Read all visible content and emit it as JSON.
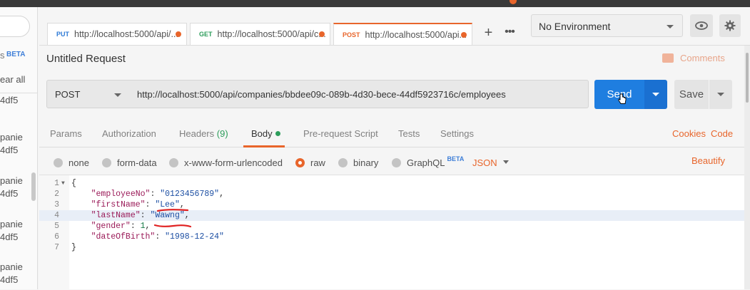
{
  "sidebar": {
    "s_fragment": "s",
    "beta": "BETA",
    "clear_all": "ear all",
    "items": [
      {
        "line1": "",
        "line2": "4df5"
      },
      {
        "line1": "panie",
        "line2": "4df5"
      },
      {
        "line1": "panie",
        "line2": "4df5"
      },
      {
        "line1": "panie",
        "line2": "4df5"
      },
      {
        "line1": "panie",
        "line2": "4df5"
      }
    ]
  },
  "tabs": [
    {
      "method": "PUT",
      "method_color": "#2d7ad6",
      "url": "http://localhost:5000/api/...",
      "active": false
    },
    {
      "method": "GET",
      "method_color": "#2d9d5b",
      "url": "http://localhost:5000/api/c...",
      "active": false
    },
    {
      "method": "POST",
      "method_color": "#e8652b",
      "url": "http://localhost:5000/api...",
      "active": true
    }
  ],
  "tab_actions": {
    "add": "+",
    "more": "•••"
  },
  "environment": {
    "selected": "No Environment"
  },
  "icons": {
    "eye": "eye-icon",
    "settings": "gear-icon",
    "comments": "comment-icon"
  },
  "request": {
    "title": "Untitled Request",
    "comments_label": "Comments",
    "method": "POST",
    "url": "http://localhost:5000/api/companies/bbdee09c-089b-4d30-bece-44df5923716c/employees",
    "send_label": "Send",
    "save_label": "Save"
  },
  "subtabs": {
    "params": "Params",
    "authorization": "Authorization",
    "headers": "Headers",
    "headers_count": "(9)",
    "body": "Body",
    "prerequest": "Pre-request Script",
    "tests": "Tests",
    "settings": "Settings",
    "cookies": "Cookies",
    "code": "Code"
  },
  "body_types": {
    "none": "none",
    "form_data": "form-data",
    "urlencoded": "x-www-form-urlencoded",
    "raw": "raw",
    "binary": "binary",
    "graphql": "GraphQL",
    "graphql_beta": "BETA",
    "format": "JSON",
    "beautify": "Beautify",
    "selected": "raw"
  },
  "editor": {
    "highlighted_line": 4,
    "lines": [
      {
        "n": "1",
        "text": "{"
      },
      {
        "n": "2",
        "key": "\"employeeNo\"",
        "sep": ": ",
        "value": "\"0123456789\"",
        "type": "s",
        "end": ","
      },
      {
        "n": "3",
        "key": "\"firstName\"",
        "sep": ": ",
        "value": "\"Lee\"",
        "type": "s",
        "end": ","
      },
      {
        "n": "4",
        "key": "\"lastName\"",
        "sep": ": ",
        "value": "\"Wawng\"",
        "type": "s",
        "end": ","
      },
      {
        "n": "5",
        "key": "\"gender\"",
        "sep": ": ",
        "value": "1",
        "type": "n",
        "end": ","
      },
      {
        "n": "6",
        "key": "\"dateOfBirth\"",
        "sep": ": ",
        "value": "\"1998-12-24\"",
        "type": "s",
        "end": ""
      },
      {
        "n": "7",
        "text": "}"
      }
    ]
  },
  "colors": {
    "accent": "#e8652b",
    "send": "#1f7ee0",
    "body_dot": "#2d9d5b"
  }
}
